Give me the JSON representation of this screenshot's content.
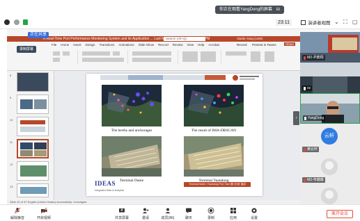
{
  "share_banner": {
    "text": "你正在观看YangDong的屏幕",
    "control": "⊟"
  },
  "top_bar": {
    "timer": "23:11",
    "view_mode": "演讲者视图",
    "window_buttons": [
      "⌄",
      "⛶",
      "▢"
    ]
  },
  "shared_screen": {
    "sharing_label": "正在共享",
    "recording_label": "录制屏幕",
    "ppt": {
      "title": "A Real-Time Port Performance Monitoring System and its Application ... Last Modified: Yesterday at 5:53 PM",
      "search_placeholder": "Search (Alt+Q)",
      "user": "Xiaolu Yang (LMS)",
      "menu": [
        "File",
        "Home",
        "Insert",
        "Design",
        "Transitions",
        "Animations",
        "Slide Show",
        "Record",
        "Review",
        "View",
        "Help",
        "Acrobat"
      ],
      "record_btn": "Record",
      "present_btn": "Present in Teams",
      "share_btn": "Share",
      "status_left": "Slide 10 of 37   English (United States)   Accessibility: Investigate"
    },
    "slide": {
      "captions": [
        "The berths and anchorages",
        "The result of IMA-DBSCAN",
        "Terminal Danie",
        "Terminal Yuandong"
      ],
      "footer_logo": "IDEAS",
      "footer_logo_sub": "Integrated Data & Analytics",
      "footer_bar": "Terminal Danie • Yuandong Port, Taixi 港口分析 演讲"
    },
    "thumbnails": [
      "8",
      "9",
      "10",
      "11",
      "12",
      "13"
    ]
  },
  "participants": [
    {
      "name": "M3-尹鹏翔",
      "mic": "off",
      "type": "video"
    },
    {
      "name": "xz",
      "mic": "on",
      "type": "video"
    },
    {
      "name": "YangDong",
      "mic": "on",
      "type": "video"
    },
    {
      "name": "黄云轩",
      "mic": "off",
      "type": "avatar",
      "avatar_text": "云轩",
      "avatar_color": "#2f7de1"
    },
    {
      "name": "M3-韦璐璐",
      "mic": "off",
      "type": "avatar-photo"
    },
    {
      "name": "",
      "mic": "off",
      "type": "avatar-photo"
    }
  ],
  "toolbar": {
    "items": [
      {
        "label": "解除静音",
        "icon": "mic-off-icon"
      },
      {
        "label": "开启视频",
        "icon": "video-off-icon"
      },
      {
        "label": "共享屏幕",
        "icon": "share-screen-icon"
      },
      {
        "label": "邀请",
        "icon": "invite-icon"
      },
      {
        "label": "成员(86)",
        "icon": "members-icon"
      },
      {
        "label": "聊天",
        "icon": "chat-icon"
      },
      {
        "label": "录制",
        "icon": "record-icon"
      },
      {
        "label": "应用",
        "icon": "apps-icon"
      },
      {
        "label": "设置",
        "icon": "settings-icon"
      }
    ],
    "leave": "离开会议"
  },
  "colors": {
    "ppt_red": "#b7472a",
    "leave_red": "#e04a3a",
    "accent_blue": "#2f7de1"
  }
}
